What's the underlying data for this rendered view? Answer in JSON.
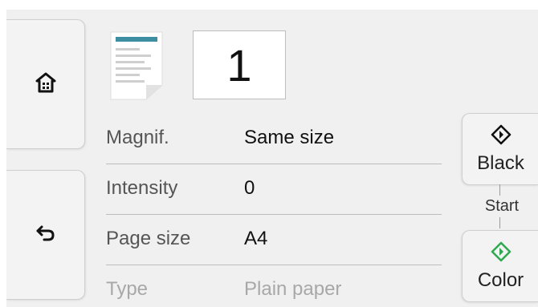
{
  "nav": {
    "home_icon": "home-icon",
    "back_icon": "back-arrow-icon"
  },
  "copies": {
    "count": "1"
  },
  "settings": [
    {
      "label": "Magnif.",
      "value": "Same size"
    },
    {
      "label": "Intensity",
      "value": "0"
    },
    {
      "label": "Page size",
      "value": "A4"
    },
    {
      "label": "Type",
      "value": "Plain paper"
    }
  ],
  "start": {
    "label": "Start",
    "black_label": "Black",
    "color_label": "Color",
    "black_icon_color": "#111111",
    "color_icon_color": "#2fa84f"
  },
  "colors": {
    "background": "#f0f0f0",
    "divider": "#bdbdbd",
    "accent_green": "#2fa84f"
  }
}
